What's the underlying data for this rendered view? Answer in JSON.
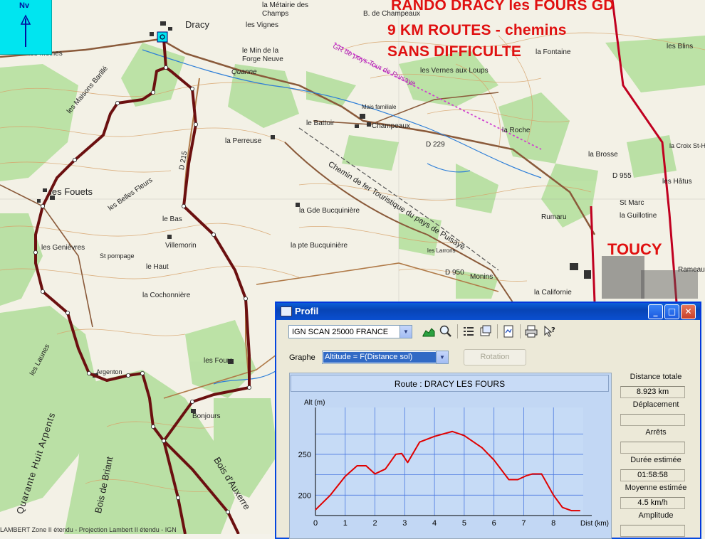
{
  "map": {
    "title_lines": [
      "RANDO DRACY les FOURS GD",
      "9 KM ROUTES - chemins",
      "SANS DIFFICULTE"
    ],
    "town_label": "TOUCY",
    "north_label": "Nv",
    "footer_text": "LAMBERT Zone II étendu - Projection Lambert II étendu - IGN",
    "place_labels": [
      "Dracy",
      "la Métairie des Champs",
      "les Vignes",
      "les Moines",
      "le Min de la Forge Neuve",
      "Quanne",
      "Champeaux",
      "le Battoir",
      "Mais familiale",
      "la Perreuse",
      "B. de Champeaux",
      "la Fontaine",
      "les Blins",
      "les Vernes aux Loups",
      "la Roche",
      "la Brosse",
      "les Hâtus",
      "St Marc",
      "la Guillotine",
      "Rumaru",
      "les Fouets",
      "les Maisons Barillé",
      "les Belles Fleurs",
      "les Genièvres",
      "St pompage",
      "Villemorin",
      "le Haut",
      "le Bas",
      "la Cochonnière",
      "la Gde Bucquinière",
      "la pte Bucquinière",
      "Chemin de fer Touristique du pays de Puisaye",
      "les Larrons",
      "Monins",
      "la Californie",
      "les Fours",
      "Bonjours",
      "Argenton",
      "Quarante Huit Arpents",
      "Bois de Briant",
      "Bois d'Auxerre",
      "les Launes",
      "D 229",
      "D 215",
      "D 950",
      "D 955",
      "GR de pays Tour de Puisaye",
      "Rameau",
      "la Croix St-Hélène"
    ]
  },
  "window": {
    "title": "Profil",
    "controls": {
      "minimize": "_",
      "maximize": "□",
      "close": "✕"
    },
    "map_source": "IGN SCAN 25000 FRANCE",
    "graphe_label": "Graphe",
    "graphe_value": "Altitude = F(Distance sol)",
    "rotation_label": "Rotation",
    "route_title": "Route : DRACY LES FOURS",
    "toolbar_icons": [
      "profile-icon",
      "zoom-icon",
      "list-icon",
      "export-icon",
      "document-icon",
      "print-icon",
      "help-icon"
    ],
    "stats": [
      {
        "label": "Distance totale",
        "value": "8.923 km"
      },
      {
        "label": "Déplacement",
        "value": ""
      },
      {
        "label": "Arrêts",
        "value": ""
      },
      {
        "label": "Durée estimée",
        "value": "01:58:58"
      },
      {
        "label": "Moyenne estimée",
        "value": "4.5 km/h"
      },
      {
        "label": "Amplitude",
        "value": ""
      }
    ]
  },
  "chart_data": {
    "type": "line",
    "title": "Route : DRACY LES FOURS",
    "xlabel": "Dist (km)",
    "ylabel": "Alt (m)",
    "x_ticks": [
      "0",
      "1",
      "2",
      "3",
      "4",
      "5",
      "6",
      "7",
      "8"
    ],
    "y_ticks": [
      "200",
      "250"
    ],
    "xlim": [
      0,
      9
    ],
    "ylim": [
      175,
      290
    ],
    "grid": true,
    "line_color": "#e00000",
    "x": [
      0,
      0.5,
      1.0,
      1.4,
      1.7,
      2.0,
      2.35,
      2.7,
      2.9,
      3.1,
      3.5,
      4.0,
      4.6,
      5.0,
      5.6,
      6.0,
      6.5,
      6.8,
      7.1,
      7.3,
      7.6,
      8.0,
      8.3,
      8.6,
      8.9
    ],
    "y": [
      182,
      200,
      223,
      236,
      236,
      226,
      232,
      250,
      251,
      240,
      265,
      272,
      278,
      273,
      258,
      243,
      219,
      219,
      224,
      226,
      226,
      200,
      185,
      181,
      181
    ]
  }
}
